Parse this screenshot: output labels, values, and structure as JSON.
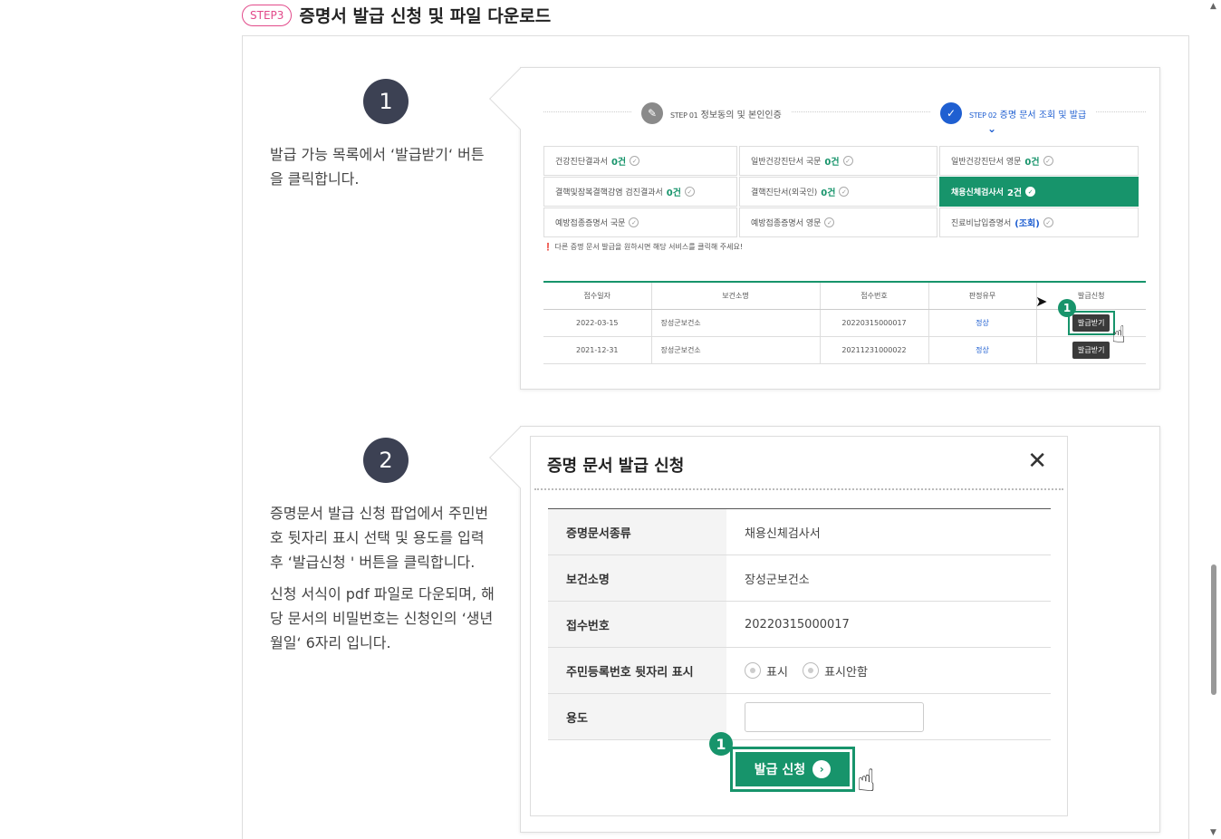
{
  "header": {
    "step_label": "STEP3",
    "title": "증명서 발급 신청 및 파일 다운로드"
  },
  "section1": {
    "number": "1",
    "description": "발급 가능 목록에서 ‘발급받기‘ 버튼을 클릭합니다.",
    "steps": [
      {
        "tag": "STEP 01",
        "label": "정보동의 및 본인인증",
        "icon": "edit-icon"
      },
      {
        "tag": "STEP 02",
        "label": "증명 문서 조회 및 발급",
        "icon": "check-icon"
      }
    ],
    "doc_types": [
      {
        "label": "건강진단결과서",
        "count": "0건"
      },
      {
        "label": "일반건강진단서 국문",
        "count": "0건"
      },
      {
        "label": "일반건강진단서 영문",
        "count": "0건"
      },
      {
        "label": "결핵및잠복결핵감염 검진결과서",
        "count": "0건"
      },
      {
        "label": "결핵진단서(외국인)",
        "count": "0건"
      },
      {
        "label": "채용신체검사서",
        "count": "2건",
        "selected": true
      },
      {
        "label": "예방접종증명서 국문",
        "count": ""
      },
      {
        "label": "예방접종증명서 영문",
        "count": ""
      },
      {
        "label": "진료비납입증명서",
        "count": "(조회)"
      }
    ],
    "notice": "다른 증명 문서 발급을 원하시면 해당 서비스를 클릭해 주세요!",
    "table": {
      "headers": [
        "접수일자",
        "보건소명",
        "접수번호",
        "판정유무",
        "발급신청"
      ],
      "rows": [
        [
          "2022-03-15",
          "장성군보건소",
          "20220315000017",
          "정상",
          "발급받기"
        ],
        [
          "2021-12-31",
          "장성군보건소",
          "20211231000022",
          "정상",
          "발급받기"
        ]
      ]
    },
    "badge": "1"
  },
  "section2": {
    "number": "2",
    "description_1": "증명문서 발급 신청 팝업에서 주민번호 뒷자리 표시 선택 및 용도를 입력 후 ‘발급신청 ' 버튼을 클릭합니다.",
    "description_2": "신청 서식이 pdf 파일로 다운되며, 해당 문서의 비밀번호는 신청인의 ‘생년월일‘ 6자리 입니다.",
    "modal": {
      "title": "증명 문서 발급 신청",
      "rows": [
        {
          "label": "증명문서종류",
          "value": "채용신체검사서"
        },
        {
          "label": "보건소명",
          "value": "장성군보건소"
        },
        {
          "label": "접수번호",
          "value": "20220315000017"
        }
      ],
      "rrn_label": "주민등록번호 뒷자리 표시",
      "rrn_options": [
        "표시",
        "표시안함"
      ],
      "purpose_label": "용도",
      "purpose_value": "",
      "submit_label": "발급 신청"
    },
    "badge": "1"
  },
  "colors": {
    "accent": "#17946b",
    "step_pill": "#e24a8a",
    "circle": "#3c4153",
    "link": "#1f5fd1"
  }
}
